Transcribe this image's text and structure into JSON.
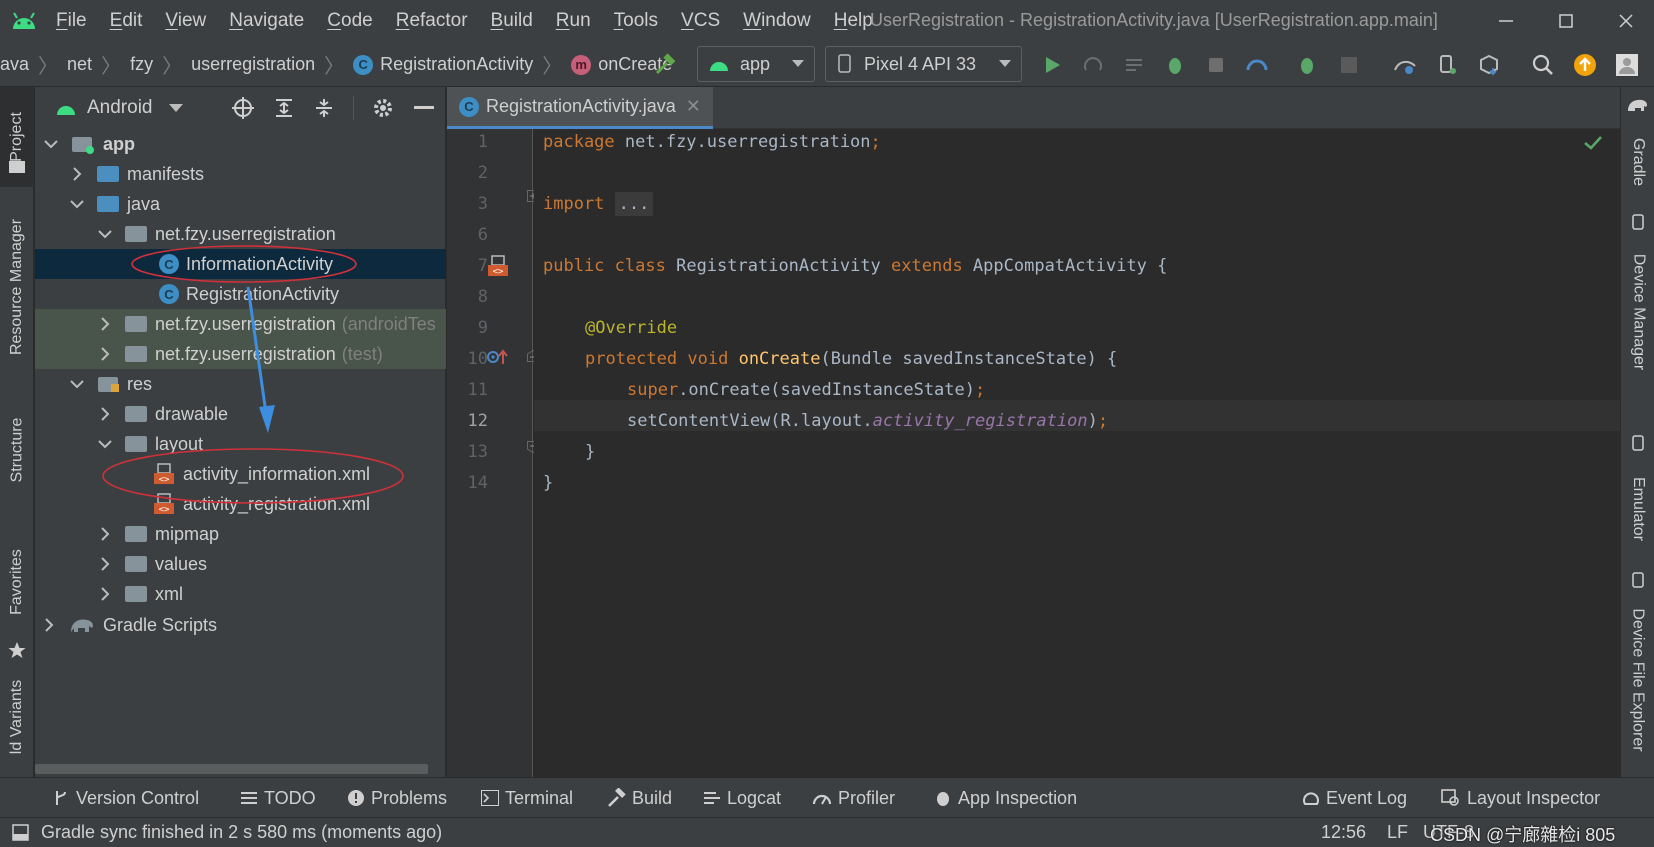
{
  "menu": {
    "items": [
      "File",
      "Edit",
      "View",
      "Navigate",
      "Code",
      "Refactor",
      "Build",
      "Run",
      "Tools",
      "VCS",
      "Window",
      "Help"
    ],
    "window_title": "UserRegistration - RegistrationActivity.java [UserRegistration.app.main]"
  },
  "breadcrumb": [
    "ava",
    "net",
    "fzy",
    "userregistration",
    "RegistrationActivity",
    "onCreate"
  ],
  "toolbar": {
    "config": "app",
    "device": "Pixel 4 API 33"
  },
  "project_panel": {
    "view_mode": "Android",
    "tree": [
      {
        "label": "app",
        "bold": true
      },
      {
        "label": "manifests"
      },
      {
        "label": "java"
      },
      {
        "label": "net.fzy.userregistration"
      },
      {
        "label": "InformationActivity",
        "selected": true
      },
      {
        "label": "RegistrationActivity"
      },
      {
        "label": "net.fzy.userregistration",
        "suffix": "(androidTes"
      },
      {
        "label": "net.fzy.userregistration",
        "suffix": "(test)"
      },
      {
        "label": "res"
      },
      {
        "label": "drawable"
      },
      {
        "label": "layout"
      },
      {
        "label": "activity_information.xml"
      },
      {
        "label": "activity_registration.xml"
      },
      {
        "label": "mipmap"
      },
      {
        "label": "values"
      },
      {
        "label": "xml"
      },
      {
        "label": "Gradle Scripts"
      }
    ]
  },
  "left_tabs": [
    "Project",
    "Resource Manager",
    "Structure",
    "Favorites",
    "ld Variants"
  ],
  "right_tabs": [
    "Gradle",
    "Device Manager",
    "Emulator",
    "Device File Explorer"
  ],
  "editor": {
    "tab_label": "RegistrationActivity.java",
    "line_numbers": [
      "1",
      "2",
      "3",
      "6",
      "7",
      "8",
      "9",
      "10",
      "11",
      "12",
      "13",
      "14"
    ],
    "code": {
      "l1_kw": "package",
      "l1_rest": " net.fzy.userregistration",
      "l1_semi": ";",
      "l3_kw": "import",
      "l3_fold": "...",
      "l7_kw1": "public",
      "l7_kw2": "class",
      "l7_name": " RegistrationActivity ",
      "l7_kw3": "extends",
      "l7_rest": " AppCompatActivity {",
      "l9_ann": "@Override",
      "l10_kw1": "protected",
      "l10_kw2": "void",
      "l10_fn": "onCreate",
      "l10_rest": "(Bundle savedInstanceState) {",
      "l11_kw": "super",
      "l11_rest": ".onCreate(savedInstanceState)",
      "l11_semi": ";",
      "l12_pre": "setContentView(R.layout.",
      "l12_it": "activity_registration",
      "l12_post": ")",
      "l12_semi": ";",
      "l13": "}",
      "l14": "}"
    }
  },
  "tool_windows": [
    "Version Control",
    "TODO",
    "Problems",
    "Terminal",
    "Build",
    "Logcat",
    "Profiler",
    "App Inspection",
    "Event Log",
    "Layout Inspector"
  ],
  "status": {
    "message": "Gradle sync finished in 2 s 580 ms (moments ago)",
    "position": "12:56",
    "line_sep": "LF",
    "encoding": "UTF-8",
    "watermark": "CSDN @宁廊雜检i 805"
  },
  "colors": {
    "accent": "#4a88c7",
    "keyword": "#cc7832",
    "annotation": "#bbb529",
    "function": "#ffc66d",
    "field": "#9876aa",
    "annotation_circle": "#d0313a",
    "annotation_arrow": "#3d8ee0"
  }
}
